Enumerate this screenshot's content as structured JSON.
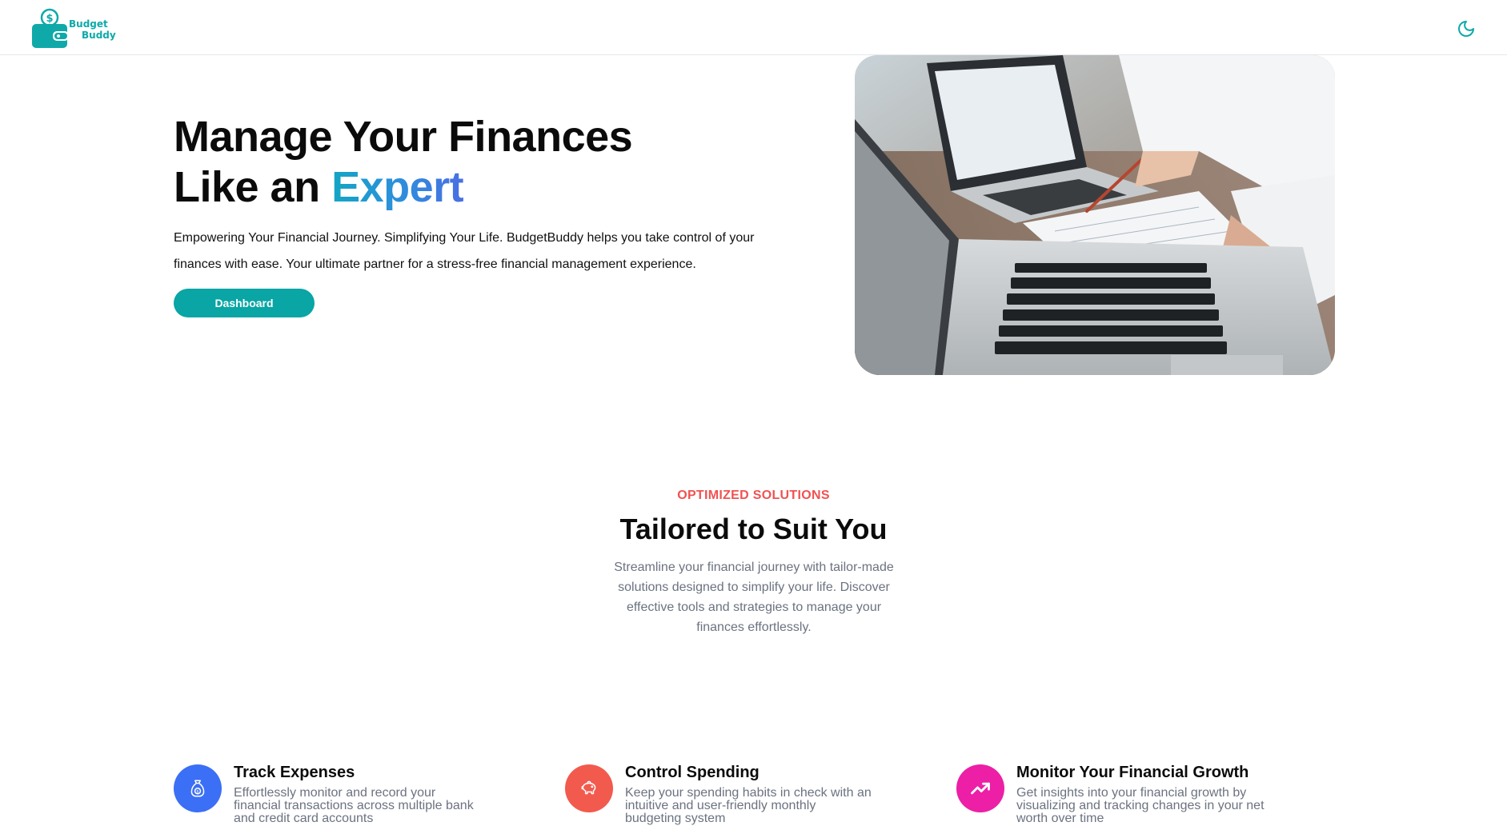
{
  "header": {
    "logo_line1": "Budget",
    "logo_line2": "Buddy",
    "theme_toggle_icon": "moon-icon"
  },
  "hero": {
    "title_line1": "Manage Your Finances",
    "title_line2_prefix": "Like an ",
    "title_line2_accent": "Expert",
    "description": "Empowering Your Financial Journey. Simplifying Your Life. BudgetBuddy helps you take control of your finances with ease. Your ultimate partner for a stress-free financial management experience.",
    "cta_label": "Dashboard",
    "image": "laptop-desk-photo"
  },
  "section": {
    "eyebrow": "OPTIMIZED SOLUTIONS",
    "title": "Tailored to Suit You",
    "description": "Streamline your financial journey with tailor-made solutions designed to simplify your life. Discover effective tools and strategies to manage your finances effortlessly."
  },
  "features": [
    {
      "title": "Track Expenses",
      "description": "Effortlessly monitor and record your financial transactions across multiple bank and credit card accounts",
      "icon": "money-bag-icon",
      "color": "#3b6ff5"
    },
    {
      "title": "Control Spending",
      "description": "Keep your spending habits in check with an intuitive and user-friendly monthly budgeting system",
      "icon": "piggy-bank-icon",
      "color": "#f25a4e"
    },
    {
      "title": "Monitor Your Financial Growth",
      "description": "Get insights into your financial growth by visualizing and tracking changes in your net worth over time",
      "icon": "trending-up-icon",
      "color": "#ec1fa6"
    }
  ],
  "colors": {
    "brand_teal": "#0aa5a5",
    "accent_red": "#f05252",
    "muted_text": "#6b7280"
  }
}
